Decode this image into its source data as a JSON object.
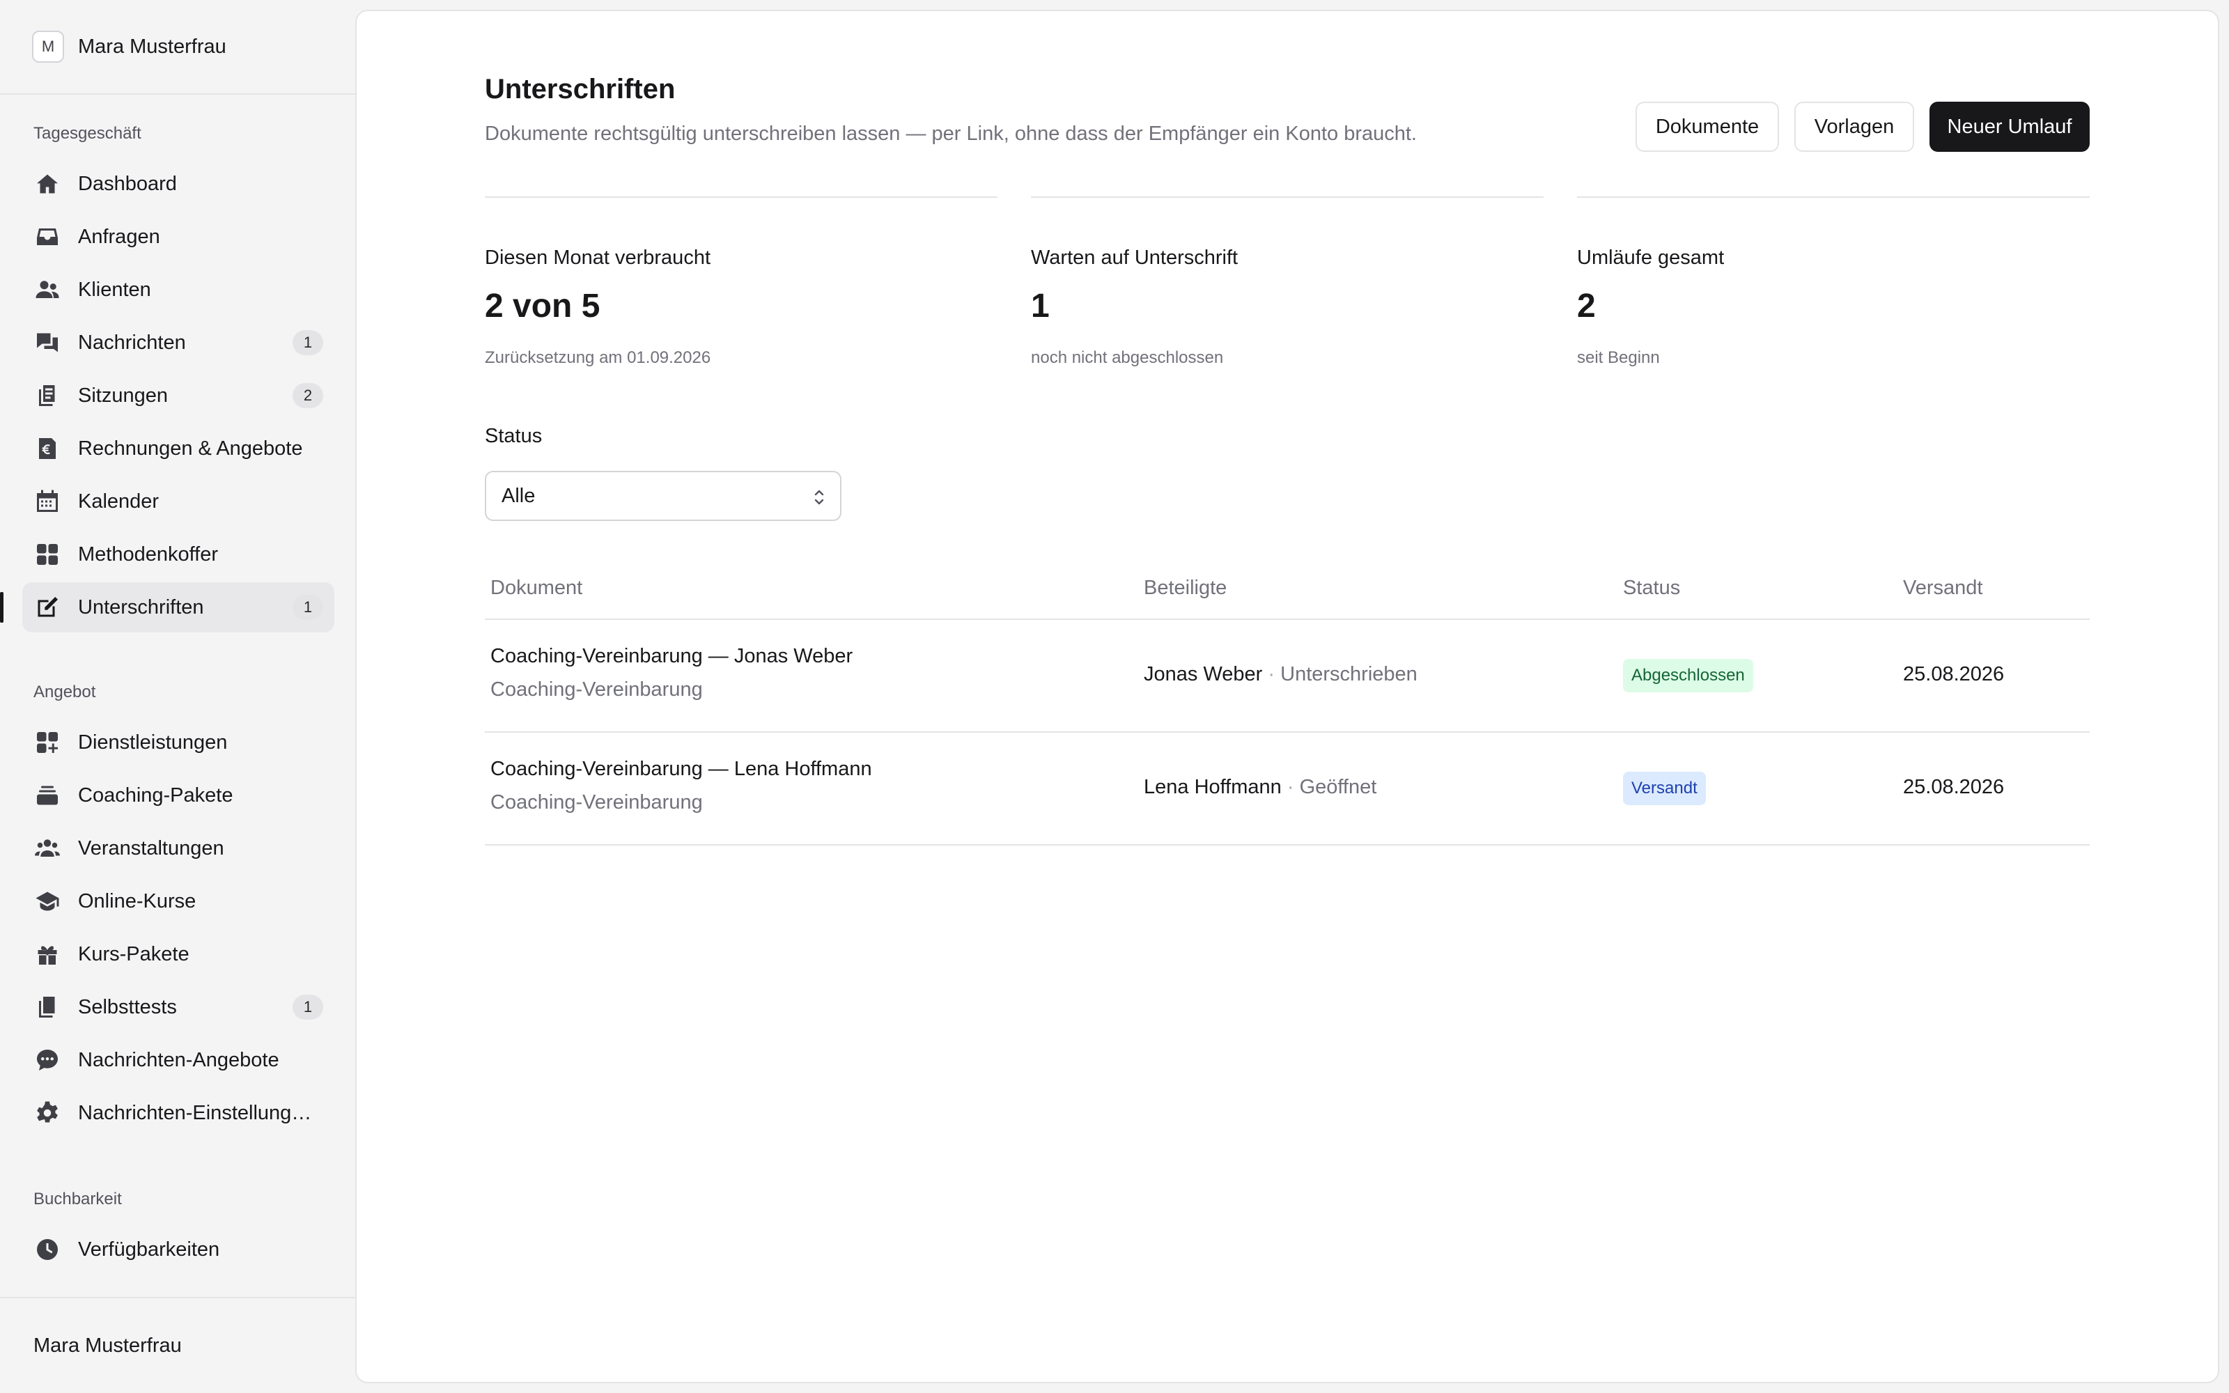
{
  "sidebar": {
    "avatar_initial": "M",
    "user_name": "Mara Musterfrau",
    "sections": [
      {
        "label": "Tagesgeschäft",
        "items": [
          {
            "label": "Dashboard",
            "icon": "home-icon",
            "badge": null
          },
          {
            "label": "Anfragen",
            "icon": "inbox-icon",
            "badge": null
          },
          {
            "label": "Klienten",
            "icon": "users-icon",
            "badge": null
          },
          {
            "label": "Nachrichten",
            "icon": "chat-icon",
            "badge": "1"
          },
          {
            "label": "Sitzungen",
            "icon": "files-icon",
            "badge": "2"
          },
          {
            "label": "Rechnungen & Angebote",
            "icon": "invoice-euro-icon",
            "badge": null
          },
          {
            "label": "Kalender",
            "icon": "calendar-icon",
            "badge": null
          },
          {
            "label": "Methodenkoffer",
            "icon": "grid-icon",
            "badge": null
          },
          {
            "label": "Unterschriften",
            "icon": "edit-icon",
            "badge": "1",
            "active": true
          }
        ]
      },
      {
        "label": "Angebot",
        "items": [
          {
            "label": "Dienstleistungen",
            "icon": "grid-plus-icon",
            "badge": null
          },
          {
            "label": "Coaching-Pakete",
            "icon": "layers-icon",
            "badge": null
          },
          {
            "label": "Veranstaltungen",
            "icon": "group-icon",
            "badge": null
          },
          {
            "label": "Online-Kurse",
            "icon": "graduation-icon",
            "badge": null
          },
          {
            "label": "Kurs-Pakete",
            "icon": "gift-icon",
            "badge": null
          },
          {
            "label": "Selbsttests",
            "icon": "checklist-icon",
            "badge": "1"
          },
          {
            "label": "Nachrichten-Angebote",
            "icon": "message-dots-icon",
            "badge": null
          },
          {
            "label": "Nachrichten-Einstellung…",
            "icon": "gear-icon",
            "badge": null
          }
        ]
      },
      {
        "label": "Buchbarkeit",
        "items": [
          {
            "label": "Verfügbarkeiten",
            "icon": "clock-icon",
            "badge": null
          }
        ]
      }
    ],
    "footer_user": "Mara Musterfrau"
  },
  "header": {
    "title": "Unterschriften",
    "subtitle": "Dokumente rechtsgültig unterschreiben lassen — per Link, ohne dass der Empfänger ein Konto braucht.",
    "buttons": {
      "documents": "Dokumente",
      "templates": "Vorlagen",
      "new": "Neuer Umlauf"
    }
  },
  "stats": [
    {
      "label": "Diesen Monat verbraucht",
      "value": "2 von 5",
      "hint": "Zurücksetzung am 01.09.2026"
    },
    {
      "label": "Warten auf Unterschrift",
      "value": "1",
      "hint": "noch nicht abgeschlossen"
    },
    {
      "label": "Umläufe gesamt",
      "value": "2",
      "hint": "seit Beginn"
    }
  ],
  "filter": {
    "label": "Status",
    "selected": "Alle"
  },
  "table": {
    "columns": [
      "Dokument",
      "Beteiligte",
      "Status",
      "Versandt"
    ],
    "rows": [
      {
        "title": "Coaching-Vereinbarung — Jonas Weber",
        "subtitle": "Coaching-Vereinbarung",
        "party": "Jonas Weber",
        "separator": " · ",
        "party_state": "Unterschrieben",
        "status": "Abgeschlossen",
        "status_kind": "done",
        "date": "25.08.2026"
      },
      {
        "title": "Coaching-Vereinbarung — Lena Hoffmann",
        "subtitle": "Coaching-Vereinbarung",
        "party": "Lena Hoffmann",
        "separator": " · ",
        "party_state": "Geöffnet",
        "status": "Versandt",
        "status_kind": "sent",
        "date": "25.08.2026"
      }
    ]
  },
  "colors": {
    "done_bg": "#dcfce7",
    "done_fg": "#166534",
    "sent_bg": "#dbeafe",
    "sent_fg": "#1e40af",
    "primary": "#18181b"
  }
}
